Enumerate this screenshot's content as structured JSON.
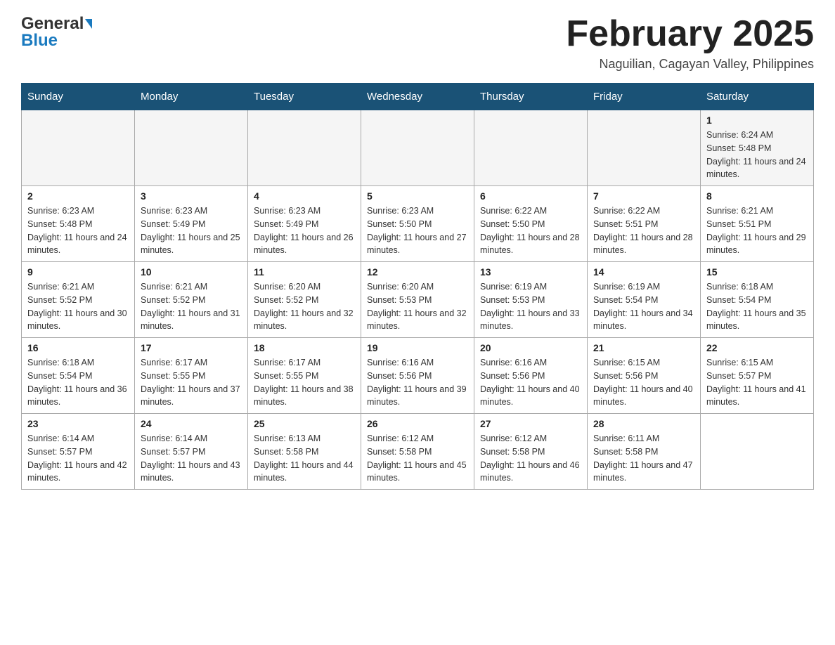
{
  "header": {
    "logo_part1": "General",
    "logo_part2": "Blue",
    "month_title": "February 2025",
    "location": "Naguilian, Cagayan Valley, Philippines"
  },
  "days_of_week": [
    "Sunday",
    "Monday",
    "Tuesday",
    "Wednesday",
    "Thursday",
    "Friday",
    "Saturday"
  ],
  "weeks": [
    [
      {
        "day": "",
        "info": ""
      },
      {
        "day": "",
        "info": ""
      },
      {
        "day": "",
        "info": ""
      },
      {
        "day": "",
        "info": ""
      },
      {
        "day": "",
        "info": ""
      },
      {
        "day": "",
        "info": ""
      },
      {
        "day": "1",
        "info": "Sunrise: 6:24 AM\nSunset: 5:48 PM\nDaylight: 11 hours and 24 minutes."
      }
    ],
    [
      {
        "day": "2",
        "info": "Sunrise: 6:23 AM\nSunset: 5:48 PM\nDaylight: 11 hours and 24 minutes."
      },
      {
        "day": "3",
        "info": "Sunrise: 6:23 AM\nSunset: 5:49 PM\nDaylight: 11 hours and 25 minutes."
      },
      {
        "day": "4",
        "info": "Sunrise: 6:23 AM\nSunset: 5:49 PM\nDaylight: 11 hours and 26 minutes."
      },
      {
        "day": "5",
        "info": "Sunrise: 6:23 AM\nSunset: 5:50 PM\nDaylight: 11 hours and 27 minutes."
      },
      {
        "day": "6",
        "info": "Sunrise: 6:22 AM\nSunset: 5:50 PM\nDaylight: 11 hours and 28 minutes."
      },
      {
        "day": "7",
        "info": "Sunrise: 6:22 AM\nSunset: 5:51 PM\nDaylight: 11 hours and 28 minutes."
      },
      {
        "day": "8",
        "info": "Sunrise: 6:21 AM\nSunset: 5:51 PM\nDaylight: 11 hours and 29 minutes."
      }
    ],
    [
      {
        "day": "9",
        "info": "Sunrise: 6:21 AM\nSunset: 5:52 PM\nDaylight: 11 hours and 30 minutes."
      },
      {
        "day": "10",
        "info": "Sunrise: 6:21 AM\nSunset: 5:52 PM\nDaylight: 11 hours and 31 minutes."
      },
      {
        "day": "11",
        "info": "Sunrise: 6:20 AM\nSunset: 5:52 PM\nDaylight: 11 hours and 32 minutes."
      },
      {
        "day": "12",
        "info": "Sunrise: 6:20 AM\nSunset: 5:53 PM\nDaylight: 11 hours and 32 minutes."
      },
      {
        "day": "13",
        "info": "Sunrise: 6:19 AM\nSunset: 5:53 PM\nDaylight: 11 hours and 33 minutes."
      },
      {
        "day": "14",
        "info": "Sunrise: 6:19 AM\nSunset: 5:54 PM\nDaylight: 11 hours and 34 minutes."
      },
      {
        "day": "15",
        "info": "Sunrise: 6:18 AM\nSunset: 5:54 PM\nDaylight: 11 hours and 35 minutes."
      }
    ],
    [
      {
        "day": "16",
        "info": "Sunrise: 6:18 AM\nSunset: 5:54 PM\nDaylight: 11 hours and 36 minutes."
      },
      {
        "day": "17",
        "info": "Sunrise: 6:17 AM\nSunset: 5:55 PM\nDaylight: 11 hours and 37 minutes."
      },
      {
        "day": "18",
        "info": "Sunrise: 6:17 AM\nSunset: 5:55 PM\nDaylight: 11 hours and 38 minutes."
      },
      {
        "day": "19",
        "info": "Sunrise: 6:16 AM\nSunset: 5:56 PM\nDaylight: 11 hours and 39 minutes."
      },
      {
        "day": "20",
        "info": "Sunrise: 6:16 AM\nSunset: 5:56 PM\nDaylight: 11 hours and 40 minutes."
      },
      {
        "day": "21",
        "info": "Sunrise: 6:15 AM\nSunset: 5:56 PM\nDaylight: 11 hours and 40 minutes."
      },
      {
        "day": "22",
        "info": "Sunrise: 6:15 AM\nSunset: 5:57 PM\nDaylight: 11 hours and 41 minutes."
      }
    ],
    [
      {
        "day": "23",
        "info": "Sunrise: 6:14 AM\nSunset: 5:57 PM\nDaylight: 11 hours and 42 minutes."
      },
      {
        "day": "24",
        "info": "Sunrise: 6:14 AM\nSunset: 5:57 PM\nDaylight: 11 hours and 43 minutes."
      },
      {
        "day": "25",
        "info": "Sunrise: 6:13 AM\nSunset: 5:58 PM\nDaylight: 11 hours and 44 minutes."
      },
      {
        "day": "26",
        "info": "Sunrise: 6:12 AM\nSunset: 5:58 PM\nDaylight: 11 hours and 45 minutes."
      },
      {
        "day": "27",
        "info": "Sunrise: 6:12 AM\nSunset: 5:58 PM\nDaylight: 11 hours and 46 minutes."
      },
      {
        "day": "28",
        "info": "Sunrise: 6:11 AM\nSunset: 5:58 PM\nDaylight: 11 hours and 47 minutes."
      },
      {
        "day": "",
        "info": ""
      }
    ]
  ]
}
